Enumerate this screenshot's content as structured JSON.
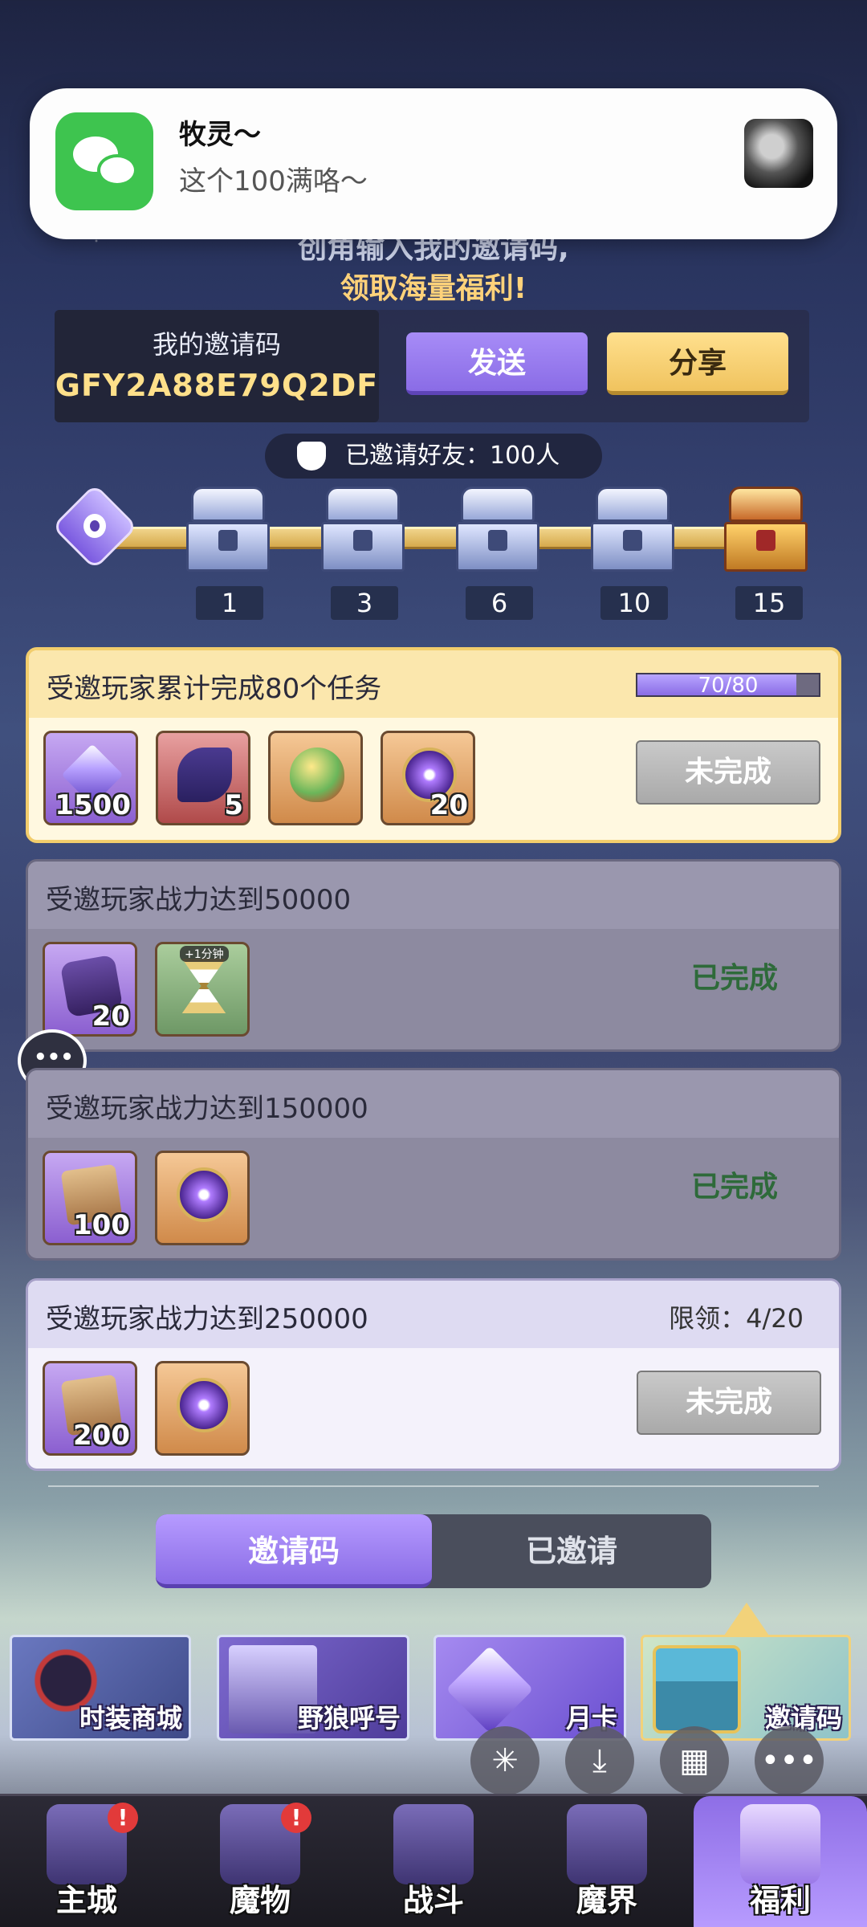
{
  "notification": {
    "app_icon": "wechat-icon",
    "title": "牧灵～",
    "message": "这个100满咯～"
  },
  "header": {
    "line1": "创角输入我的邀请码,",
    "line2": "领取海量福利!"
  },
  "invite": {
    "label": "我的邀请码",
    "code": "GFY2A88E79Q2DF",
    "send_label": "发送",
    "share_label": "分享",
    "invited_text": "已邀请好友：100人"
  },
  "milestones": [
    "1",
    "3",
    "6",
    "10",
    "15"
  ],
  "tasks": [
    {
      "title": "受邀玩家累计完成80个任务",
      "progress_text": "70/80",
      "progress": 0.875,
      "rewards": [
        {
          "icon": "crystal-icon",
          "qty": "1500"
        },
        {
          "icon": "scroll-icon",
          "qty": "5"
        },
        {
          "icon": "egg-icon",
          "qty": ""
        },
        {
          "icon": "orb-icon",
          "qty": "20"
        }
      ],
      "status": "未完成"
    },
    {
      "title": "受邀玩家战力达到50000",
      "rewards": [
        {
          "icon": "stone-icon",
          "qty": "20"
        },
        {
          "icon": "hourglass-icon",
          "qty": "",
          "badge": "+1分钟"
        }
      ],
      "status": "已完成"
    },
    {
      "title": "受邀玩家战力达到150000",
      "rewards": [
        {
          "icon": "map-icon",
          "qty": "100"
        },
        {
          "icon": "orb-icon",
          "qty": ""
        }
      ],
      "status": "已完成"
    },
    {
      "title": "受邀玩家战力达到250000",
      "limit": "限领：4/20",
      "rewards": [
        {
          "icon": "map-icon",
          "qty": "200"
        },
        {
          "icon": "orb-icon",
          "qty": ""
        }
      ],
      "status": "未完成"
    }
  ],
  "tabs": {
    "active": "邀请码",
    "inactive": "已邀请"
  },
  "banners": [
    "时装商城",
    "野狼呼号",
    "月卡",
    "邀请码"
  ],
  "fabs": [
    "pinwheel-icon",
    "download-icon",
    "grid-icon",
    "more-icon"
  ],
  "nav": [
    {
      "label": "主城",
      "alert": "!"
    },
    {
      "label": "魔物",
      "alert": "!"
    },
    {
      "label": "战斗",
      "alert": ""
    },
    {
      "label": "魔界",
      "alert": ""
    },
    {
      "label": "福利",
      "alert": ""
    }
  ],
  "colors": {
    "accent_purple": "#8a6ce6",
    "accent_gold": "#f0c35e",
    "done_green": "#2e6a3a",
    "code_gold": "#ffe08a"
  }
}
